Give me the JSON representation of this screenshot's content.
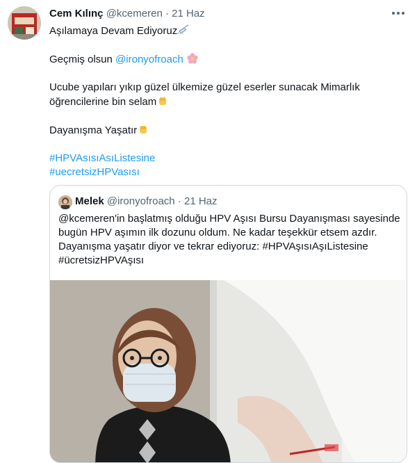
{
  "tweet": {
    "author_name": "Cem Kılınç",
    "author_handle": "@kcemeren",
    "separator": "·",
    "date": "21 Haz",
    "more_icon": "more-horizontal-icon",
    "lines": {
      "l1": "Aşılamaya Devam Ediyoruz",
      "l2_prefix": "Geçmiş olsun ",
      "l2_mention": "@ironyofroach",
      "l3": "Ucube yapıları yıkıp güzel ülkemize güzel eserler sunacak Mimarlık",
      "l4": "öğrencilerine bin selam",
      "l5": "Dayanışma Yaşatır",
      "hashtag1": "#HPVAsısıAsıListesine",
      "hashtag2": "#uecretsizHPVasısı"
    }
  },
  "quoted": {
    "author_name": "Melek",
    "author_handle": "@ironyofroach",
    "separator": "·",
    "date": "21 Haz",
    "lines": {
      "l1": "@kcemeren'in başlatmış olduğu HPV Aşısı Bursu Dayanışması sayesinde",
      "l2": "bugün HPV aşımın ilk dozunu oldum. Ne kadar teşekkür etsem azdır.",
      "l3": "Dayanışma yaşatır diyor ve tekrar ediyoruz: #HPVAşısıAşıListesine",
      "l4": "#ücretsizHPVAşısı"
    }
  }
}
